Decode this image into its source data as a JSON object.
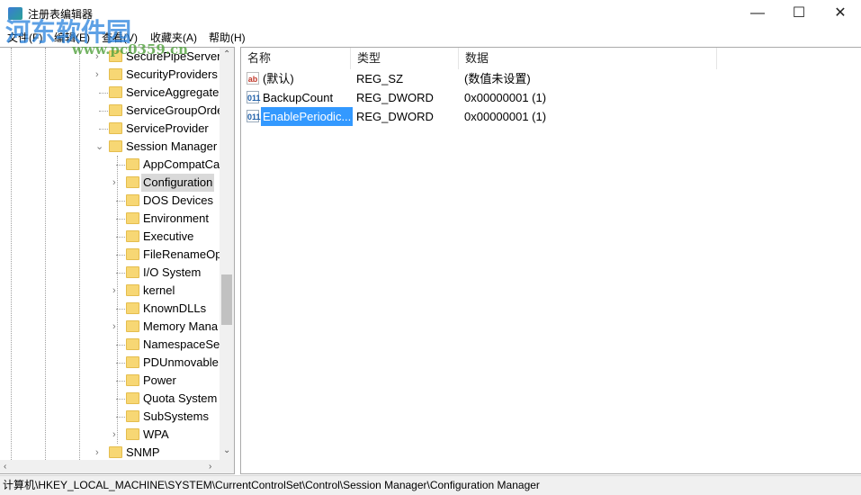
{
  "window": {
    "title": "注册表编辑器",
    "minimize": "—",
    "maximize": "☐",
    "close": "✕"
  },
  "menu": [
    "文件(F)",
    "编辑(E)",
    "查看(V)",
    "收藏夹(A)",
    "帮助(H)"
  ],
  "watermark": {
    "text": "河东软件园",
    "url": "www.pc0359.cn"
  },
  "tree": [
    {
      "label": "SecurePipeServers",
      "level": 1,
      "exp": ">"
    },
    {
      "label": "SecurityProviders",
      "level": 1,
      "exp": ">"
    },
    {
      "label": "ServiceAggregate",
      "level": 1,
      "exp": ""
    },
    {
      "label": "ServiceGroupOrde",
      "level": 1,
      "exp": ""
    },
    {
      "label": "ServiceProvider",
      "level": 1,
      "exp": ""
    },
    {
      "label": "Session Manager",
      "level": 1,
      "exp": "v"
    },
    {
      "label": "AppCompatCa",
      "level": 2,
      "exp": ""
    },
    {
      "label": "Configuration",
      "level": 2,
      "exp": ">",
      "selected": true
    },
    {
      "label": "DOS Devices",
      "level": 2,
      "exp": ""
    },
    {
      "label": "Environment",
      "level": 2,
      "exp": ""
    },
    {
      "label": "Executive",
      "level": 2,
      "exp": ""
    },
    {
      "label": "FileRenameOp",
      "level": 2,
      "exp": ""
    },
    {
      "label": "I/O System",
      "level": 2,
      "exp": ""
    },
    {
      "label": "kernel",
      "level": 2,
      "exp": ">"
    },
    {
      "label": "KnownDLLs",
      "level": 2,
      "exp": ""
    },
    {
      "label": "Memory Mana",
      "level": 2,
      "exp": ">"
    },
    {
      "label": "NamespaceSe",
      "level": 2,
      "exp": ""
    },
    {
      "label": "PDUnmovableI",
      "level": 2,
      "exp": ""
    },
    {
      "label": "Power",
      "level": 2,
      "exp": ""
    },
    {
      "label": "Quota System",
      "level": 2,
      "exp": ""
    },
    {
      "label": "SubSystems",
      "level": 2,
      "exp": ""
    },
    {
      "label": "WPA",
      "level": 2,
      "exp": ">"
    },
    {
      "label": "SNMP",
      "level": 1,
      "exp": ">"
    }
  ],
  "columns": {
    "name": "名称",
    "type": "类型",
    "data": "数据"
  },
  "values": [
    {
      "icon": "ab",
      "name": "(默认)",
      "type": "REG_SZ",
      "data": "(数值未设置)"
    },
    {
      "icon": "011",
      "name": "BackupCount",
      "type": "REG_DWORD",
      "data": "0x00000001 (1)"
    },
    {
      "icon": "011",
      "name": "EnablePeriodic...",
      "type": "REG_DWORD",
      "data": "0x00000001 (1)",
      "selected": true
    }
  ],
  "status": "计算机\\HKEY_LOCAL_MACHINE\\SYSTEM\\CurrentControlSet\\Control\\Session Manager\\Configuration Manager"
}
